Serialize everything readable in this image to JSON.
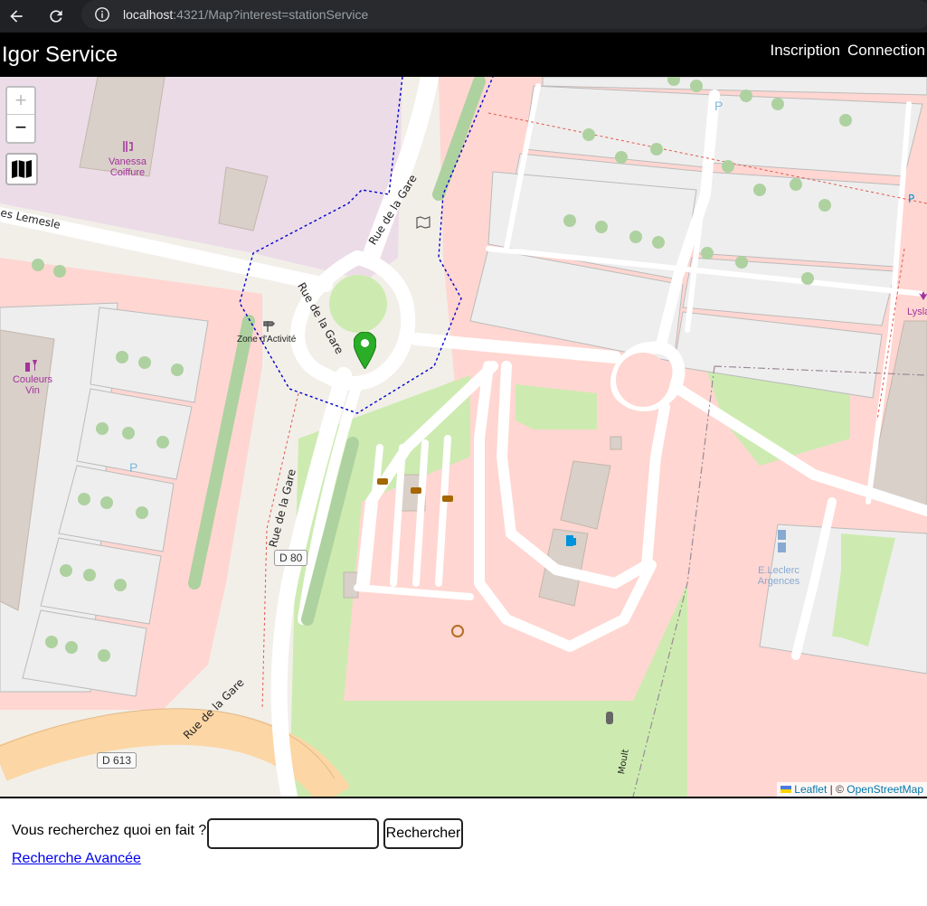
{
  "browser": {
    "url_host": "localhost",
    "url_rest": ":4321/Map?interest=stationService"
  },
  "header": {
    "brand": "Igor Service",
    "nav": [
      "Inscription",
      "Connection"
    ]
  },
  "map": {
    "zoom_in": "+",
    "zoom_out": "−",
    "attribution_leaflet": "Leaflet",
    "attribution_sep": " | © ",
    "attribution_osm": "OpenStreetMap",
    "labels": {
      "vanessa": "Vanessa\nCoiffure",
      "zone": "Zone d'Activité",
      "couleurs": "Couleurs\nVin",
      "leclerc": "E.Leclerc\nArgences",
      "lysla": "Lysla",
      "lemesle": "es Lemesle",
      "rue_gare_1": "Rue de la Gare",
      "rue_gare_2": "Rue de la Gare",
      "rue_gare_3": "Rue de la Gare",
      "rue_gare_4": "Rue de la Gare",
      "moult": "Moult",
      "d80": "D 80",
      "d613": "D 613",
      "parking_1": "P",
      "parking_2": "P"
    },
    "colors": {
      "background": "#f2efe9",
      "retail": "#ffd6d1",
      "building": "#d9d0c9",
      "grass": "#cdebb0",
      "road": "#ffffff",
      "primary": "#fcd6a4",
      "marker": "#2aad27"
    }
  },
  "search": {
    "label": "Vous recherchez quoi en fait ?",
    "input_value": "",
    "button": "Rechercher",
    "advanced_link": "Recherche Avancée"
  }
}
